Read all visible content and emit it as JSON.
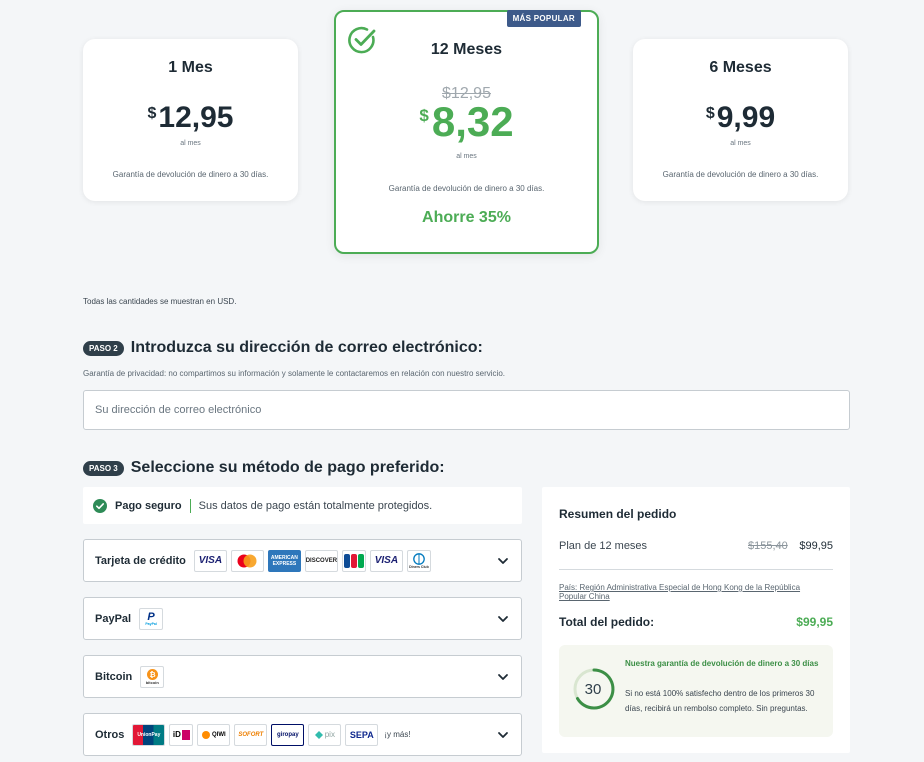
{
  "plans": {
    "one": {
      "name": "1 Mes",
      "currency": "$",
      "price": "12,95",
      "per": "al mes",
      "guarantee": "Garantía de devolución de dinero a 30 días."
    },
    "twelve": {
      "name": "12 Meses",
      "badge": "MÁS POPULAR",
      "old_price": "$12,95",
      "currency": "$",
      "price": "8,32",
      "per": "al mes",
      "guarantee": "Garantía de devolución de dinero a 30 días.",
      "savings": "Ahorre 35%"
    },
    "six": {
      "name": "6 Meses",
      "currency": "$",
      "price": "9,99",
      "per": "al mes",
      "guarantee": "Garantía de devolución de dinero a 30 días."
    }
  },
  "usd_note": {
    "text": "Todas las cantidades se muestran en ",
    "currency": "USD",
    "end": "."
  },
  "step2": {
    "pill": "PASO 2",
    "title": "Introduzca su dirección de correo electrónico:",
    "privacy": "Garantía de privacidad: no compartimos su información y solamente le contactaremos en relación con nuestro servicio.",
    "email_placeholder": "Su dirección de correo electrónico",
    "email_value": ""
  },
  "step3": {
    "pill": "PASO 3",
    "title": "Seleccione su método de pago preferido:"
  },
  "secure": {
    "strong": "Pago seguro",
    "text": "Sus datos de pago están totalmente protegidos."
  },
  "payment_methods": [
    {
      "label": "Tarjeta de crédito"
    },
    {
      "label": "PayPal"
    },
    {
      "label": "Bitcoin"
    },
    {
      "label": "Otros",
      "more": "¡y más!"
    }
  ],
  "logos": {
    "visa": "VISA",
    "amex": "AMERICAN EXPRESS",
    "discover": "DISCOVER",
    "jcb": "JCB",
    "diners": "Diners Club",
    "paypal": "PayPal",
    "bitcoin": "bitcoin",
    "unionpay": "UnionPay",
    "ideal": "iD",
    "qiwi": "QIWI",
    "sofort": "SOFORT",
    "giropay": "giropay",
    "pix": "pix",
    "sepa": "SEPA"
  },
  "summary": {
    "title": "Resumen del pedido",
    "plan": "Plan de 12 meses",
    "old": "$155,40",
    "new": "$99,95",
    "country": "País: Región Administrativa Especial de Hong Kong de la República Popular China",
    "total_label": "Total del pedido:",
    "total": "$99,95",
    "guarantee_days": "30",
    "guarantee_title": "Nuestra garantía de devolución de dinero a 30 días",
    "guarantee_text": "Si no está 100% satisfecho dentro de los primeros 30 días, recibirá un rembolso completo. Sin preguntas."
  },
  "colors": {
    "accent": "#4cac55",
    "badge": "#3d5a8a",
    "text": "#1e2b35",
    "step_pill": "#2f3f4a"
  }
}
